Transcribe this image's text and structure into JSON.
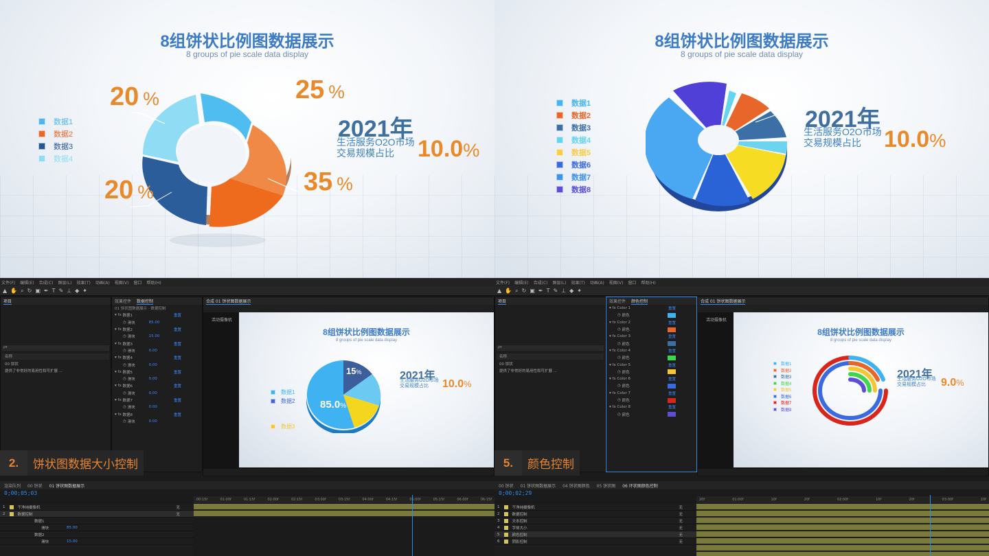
{
  "slide_title_cn": "8组饼状比例图数据展示",
  "slide_title_en": "8 groups of pie scale data display",
  "info": {
    "year": "2021年",
    "desc_line1": "生活服务O2O市场",
    "desc_line2": "交易规模占比"
  },
  "top_left": {
    "legend": [
      {
        "label": "数据1",
        "color": "#4fb7ee"
      },
      {
        "label": "数据2",
        "color": "#e8662a"
      },
      {
        "label": "数据3",
        "color": "#24578f"
      },
      {
        "label": "数据4",
        "color": "#8fdcf4"
      }
    ],
    "labels": {
      "l1_num": "20",
      "l2_num": "25",
      "l3_num": "20",
      "l4_num": "35",
      "unit": "%"
    },
    "big_pct": "10.0",
    "big_unit": "%"
  },
  "top_right": {
    "legend": [
      {
        "label": "数据1",
        "color": "#47b5f1"
      },
      {
        "label": "数据2",
        "color": "#e8662a"
      },
      {
        "label": "数据3",
        "color": "#3c6fa6"
      },
      {
        "label": "数据4",
        "color": "#63d5ef"
      },
      {
        "label": "数据5",
        "color": "#f7cd4a"
      },
      {
        "label": "数据6",
        "color": "#3a6ae0"
      },
      {
        "label": "数据7",
        "color": "#3d92ea"
      },
      {
        "label": "数据8",
        "color": "#5a4fd6"
      }
    ],
    "big_pct": "10.0",
    "big_unit": "%"
  },
  "ae_left": {
    "menu": [
      "文件(F)",
      "编辑(E)",
      "合成(C)",
      "图层(L)",
      "效果(T)",
      "动画(A)",
      "视图(V)",
      "窗口",
      "帮助(H)"
    ],
    "project_label": "项目",
    "project_search": "ρ▾",
    "project_col": "名称",
    "project_items": [
      "00 饼状",
      "提供了非常好的易用性和可扩展 ..."
    ],
    "effects_tab_prefix": "效果控件",
    "effects_tab_name": "数据控制",
    "effects_path": "01 饼状图数据展示 · 数据控制",
    "effects": [
      {
        "name": "数据1",
        "reset": "重置",
        "param": "滑块",
        "val": "85.00"
      },
      {
        "name": "数据2",
        "reset": "重置",
        "param": "滑块",
        "val": "15.00"
      },
      {
        "name": "数据3",
        "reset": "重置",
        "param": "滑块",
        "val": "0.00"
      },
      {
        "name": "数据4",
        "reset": "重置",
        "param": "滑块",
        "val": "0.00"
      },
      {
        "name": "数据5",
        "reset": "重置",
        "param": "滑块",
        "val": "0.00"
      },
      {
        "name": "数据6",
        "reset": "重置",
        "param": "滑块",
        "val": "0.00"
      },
      {
        "name": "数据7",
        "reset": "重置",
        "param": "滑块",
        "val": "0.00"
      },
      {
        "name": "数据8",
        "reset": "重置",
        "param": "滑块",
        "val": "0.00"
      }
    ],
    "comp_tab": "合成 01 饼状图数据展示",
    "comp_side": "活动摄像机",
    "mini": {
      "title_cn": "8组饼状比例图数据展示",
      "title_en": "8 groups of pie scale data display",
      "legend": [
        "数据1",
        "数据2",
        "数据3"
      ],
      "legend_colors": [
        "#3fb3f2",
        "#3f66d8",
        "#f5c62f"
      ],
      "pct_big": "85.0",
      "pct_small": "15",
      "unit": "%",
      "big_pct": "10.0"
    },
    "caption_num": "2.",
    "caption_text": "饼状图数据大小控制",
    "timecode": "0;00;05;03",
    "tl_tabs": [
      "渲染队列",
      "00 饼状",
      "01 饼状图数据展示"
    ],
    "ruler_ticks": [
      "00:15f",
      "01:00f",
      "01:15f",
      "02:00f",
      "02:15f",
      "03:00f",
      "03:15f",
      "04:00f",
      "04:15f",
      "05:00f",
      "05:15f",
      "06:00f",
      "06:15f"
    ],
    "layers": [
      {
        "num": "1",
        "name": "干净纯摄像机",
        "mode": "无"
      },
      {
        "num": "2",
        "name": "数据控制",
        "mode": "无"
      }
    ],
    "sub_rows": [
      {
        "name": "数据1",
        "param": "滑块",
        "val": "85.00"
      },
      {
        "name": "数据2",
        "param": "滑块",
        "val": "15.00"
      }
    ]
  },
  "ae_right": {
    "effects_tab_name": "颜色控制",
    "effects": [
      {
        "name": "Color 1",
        "color": "#3fb3f2"
      },
      {
        "name": "Color 2",
        "color": "#e8662a"
      },
      {
        "name": "Color 3",
        "color": "#3c6fa6"
      },
      {
        "name": "Color 4",
        "color": "#3ed64a"
      },
      {
        "name": "Color 5",
        "color": "#f5c62f"
      },
      {
        "name": "Color 6",
        "color": "#3a6ae0"
      },
      {
        "name": "Color 7",
        "color": "#d9261c"
      },
      {
        "name": "Color 8",
        "color": "#5a4fd6"
      }
    ],
    "effect_reset": "重置",
    "effect_param": "颜色",
    "mini": {
      "legend": [
        "数据1",
        "数据2",
        "数据3",
        "数据4",
        "数据5",
        "数据6",
        "数据7",
        "数据8"
      ],
      "legend_colors": [
        "#3fb3f2",
        "#e8662a",
        "#3c6fa6",
        "#3ed64a",
        "#f5c62f",
        "#3a6ae0",
        "#d9261c",
        "#5a4fd6"
      ],
      "big_pct": "9.0"
    },
    "caption_num": "5.",
    "caption_text": "颜色控制",
    "timecode": "0;00;02;29",
    "tl_tabs": [
      "00 饼状",
      "01 饼状图数据展示",
      "04 饼状图颜色",
      "05 饼状图",
      "06 环状图颜色控制"
    ],
    "ruler_ticks": [
      "20f",
      "01:00f",
      "10f",
      "20f",
      "02:00f",
      "10f",
      "20f",
      "03:00f",
      "10f"
    ],
    "layers": [
      {
        "num": "1",
        "name": "干净纯摄像机",
        "mode": "无"
      },
      {
        "num": "2",
        "name": "数据控制",
        "mode": "无"
      },
      {
        "num": "3",
        "name": "文本控制",
        "mode": "无"
      },
      {
        "num": "4",
        "name": "字体大小",
        "mode": "无"
      },
      {
        "num": "5",
        "name": "颜色控制",
        "mode": "无"
      },
      {
        "num": "6",
        "name": "阴影控制",
        "mode": "无"
      }
    ]
  },
  "colors": {
    "accent_blue": "#2d8ceb",
    "orange": "#e8892a",
    "layer_bar": "#7b7a3d"
  }
}
